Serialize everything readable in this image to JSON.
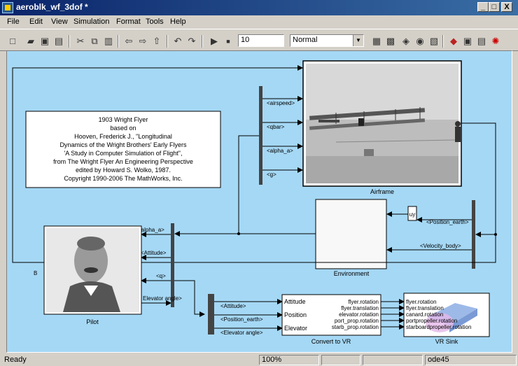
{
  "window": {
    "title": "aeroblk_wf_3dof *",
    "controls": [
      "_",
      "□",
      "X"
    ]
  },
  "menu": [
    "File",
    "Edit",
    "View",
    "Simulation",
    "Format",
    "Tools",
    "Help"
  ],
  "toolbar": {
    "stop_time": "10",
    "sim_mode": "Normal"
  },
  "annotation": [
    "1903 Wright Flyer",
    "based on",
    "Hooven, Frederick J., \"Longitudinal",
    "Dynamics of the Wright Brothers' Early Flyers",
    "'A Study in Computer Simulation of Flight\",",
    "from The Wright Flyer An Engineering Perspective",
    "edited by Howard S. Wolko, 1987.",
    "Copyright 1990-2006 The MathWorks, Inc."
  ],
  "blocks": {
    "airframe": "Airframe",
    "environment": "Environment",
    "pilot": "Pilot",
    "convert": "Convert to VR",
    "vrsink": "VR Sink"
  },
  "signals": {
    "airspeed": "<airspeed>",
    "qbar": "<qbar>",
    "alpha_a_top": "<alpha_a>",
    "g": "<g>",
    "position_earth": "<Position_earth>",
    "velocity_body": "<Velocity_body>",
    "alpha_a_pilot": "<alpha_a>",
    "attitude_pilot": "<Attitude>",
    "q": "<q>",
    "elevator_angle": "Elevator angle>",
    "attitude_vr": "<Attitude>",
    "position_vr": "<Position_earth>",
    "elevator_vr": "<Elevator angle>",
    "B": "B",
    "uy": "uy"
  },
  "convert_ports_in": [
    "Attitude",
    "Position",
    "Elevator"
  ],
  "convert_ports_out": [
    "flyer.rotation",
    "flyer.translation",
    "elevator.rotation",
    "port_prop.rotation",
    "starb_prop.rotation"
  ],
  "vrsink_ports": [
    "flyer.rotation",
    "flyer.translation",
    "canard.rotation",
    "portpropeller.rotation",
    "starboardpropeller.rotation"
  ],
  "status": {
    "left": "Ready",
    "zoom": "100%",
    "solver": "ode45"
  }
}
